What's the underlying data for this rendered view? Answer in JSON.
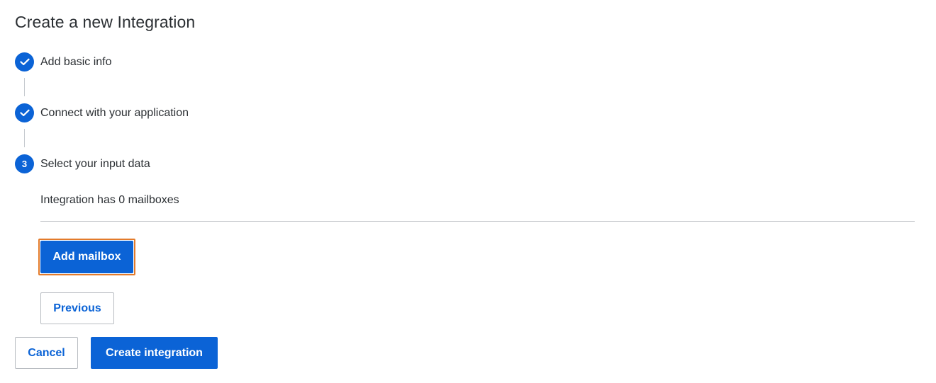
{
  "page": {
    "title": "Create a new Integration"
  },
  "steps": [
    {
      "label": "Add basic info",
      "status": "complete",
      "icon": "check-icon"
    },
    {
      "label": "Connect with your application",
      "status": "complete",
      "icon": "check-icon"
    },
    {
      "label": "Select your input data",
      "status": "active",
      "number": "3"
    }
  ],
  "input_data": {
    "summary": "Integration has 0 mailboxes",
    "add_mailbox_label": "Add mailbox",
    "previous_label": "Previous"
  },
  "footer": {
    "cancel_label": "Cancel",
    "create_label": "Create integration"
  },
  "colors": {
    "primary": "#0b63d6",
    "focus": "#e37b2b",
    "border": "#b8bcc1"
  }
}
